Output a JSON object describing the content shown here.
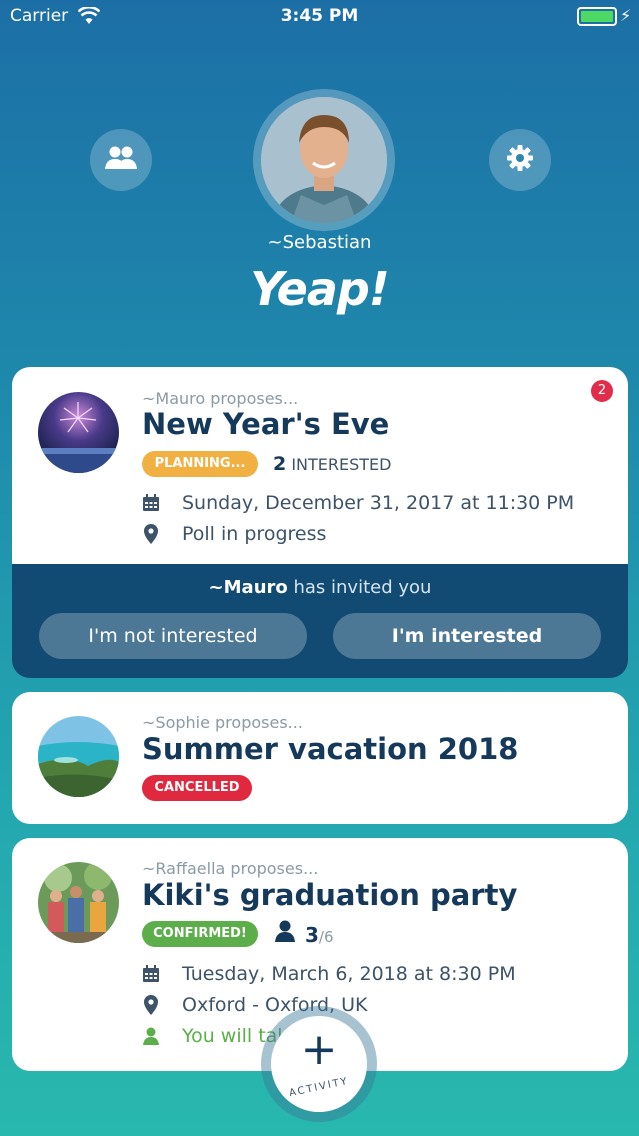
{
  "status_bar": {
    "carrier": "Carrier",
    "time": "3:45 PM"
  },
  "header": {
    "username": "~Sebastian",
    "logo": "Yeap!"
  },
  "cards": [
    {
      "proposer": "~Mauro proposes...",
      "title": "New Year's Eve",
      "status": "PLANNING...",
      "status_color": "#f0b042",
      "interested_count": "2",
      "interested_label": "INTERESTED",
      "date": "Sunday, December 31, 2017 at 11:30 PM",
      "location": "Poll in progress",
      "notification_count": "2",
      "invite": {
        "inviter": "~Mauro",
        "text": "has invited you"
      },
      "buttons": {
        "not_interested": "I'm not interested",
        "interested": "I'm interested"
      }
    },
    {
      "proposer": "~Sophie proposes...",
      "title": "Summer vacation 2018",
      "status": "CANCELLED",
      "status_color": "#e0283e"
    },
    {
      "proposer": "~Raffaella proposes...",
      "title": "Kiki's graduation party",
      "status": "CONFIRMED!",
      "status_color": "#5cae4a",
      "attendees": "3",
      "capacity": "/6",
      "date": "Tuesday, March 6, 2018 at 8:30 PM",
      "location": "Oxford - Oxford, UK",
      "note": "You will tak"
    }
  ],
  "fab": {
    "label": "ACTIVITY"
  },
  "icons": {
    "friends": "friends-icon",
    "settings": "gear-icon",
    "calendar": "calendar-icon",
    "location": "location-pin-icon",
    "person": "person-icon",
    "plus": "plus-icon",
    "wifi": "wifi-icon",
    "battery": "battery-icon"
  }
}
